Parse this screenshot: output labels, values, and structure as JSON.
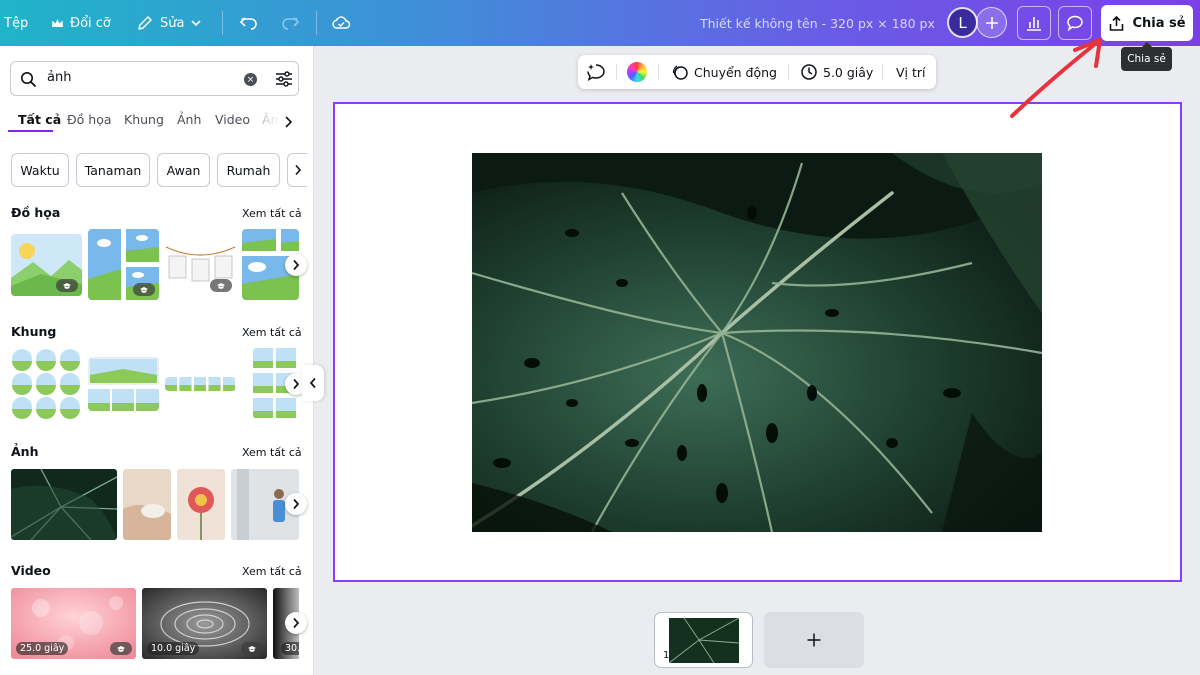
{
  "topbar": {
    "file": "Tệp",
    "resize": "Đổi cỡ",
    "edit": "Sửa",
    "doc_title": "Thiết kế không tên - 320 px × 180 px",
    "avatar_letter": "L",
    "share": "Chia sẻ",
    "share_tooltip": "Chia sẻ",
    "gradient": [
      "#1fb4c9",
      "#7b3fe8"
    ]
  },
  "search": {
    "value": "ảnh",
    "clear_icon": "×"
  },
  "tabs": [
    "Tất cả",
    "Đồ họa",
    "Khung",
    "Ảnh",
    "Video",
    "Âm"
  ],
  "chips": [
    "Waktu",
    "Tanaman",
    "Awan",
    "Rumah"
  ],
  "sections": {
    "graphics": {
      "title": "Đồ họa",
      "see_all": "Xem tất cả"
    },
    "frames": {
      "title": "Khung",
      "see_all": "Xem tất cả"
    },
    "photos": {
      "title": "Ảnh",
      "see_all": "Xem tất cả"
    },
    "videos": {
      "title": "Video",
      "see_all": "Xem tất cả",
      "durations": [
        "25.0 giây",
        "10.0 giây",
        "30."
      ]
    }
  },
  "floating_toolbar": {
    "animation": "Chuyển động",
    "duration": "5.0 giây",
    "position": "Vị trí"
  },
  "pages": {
    "current_page": "1"
  },
  "colors": {
    "accent": "#8b3dff",
    "annotation_arrow": "#e8323c"
  }
}
